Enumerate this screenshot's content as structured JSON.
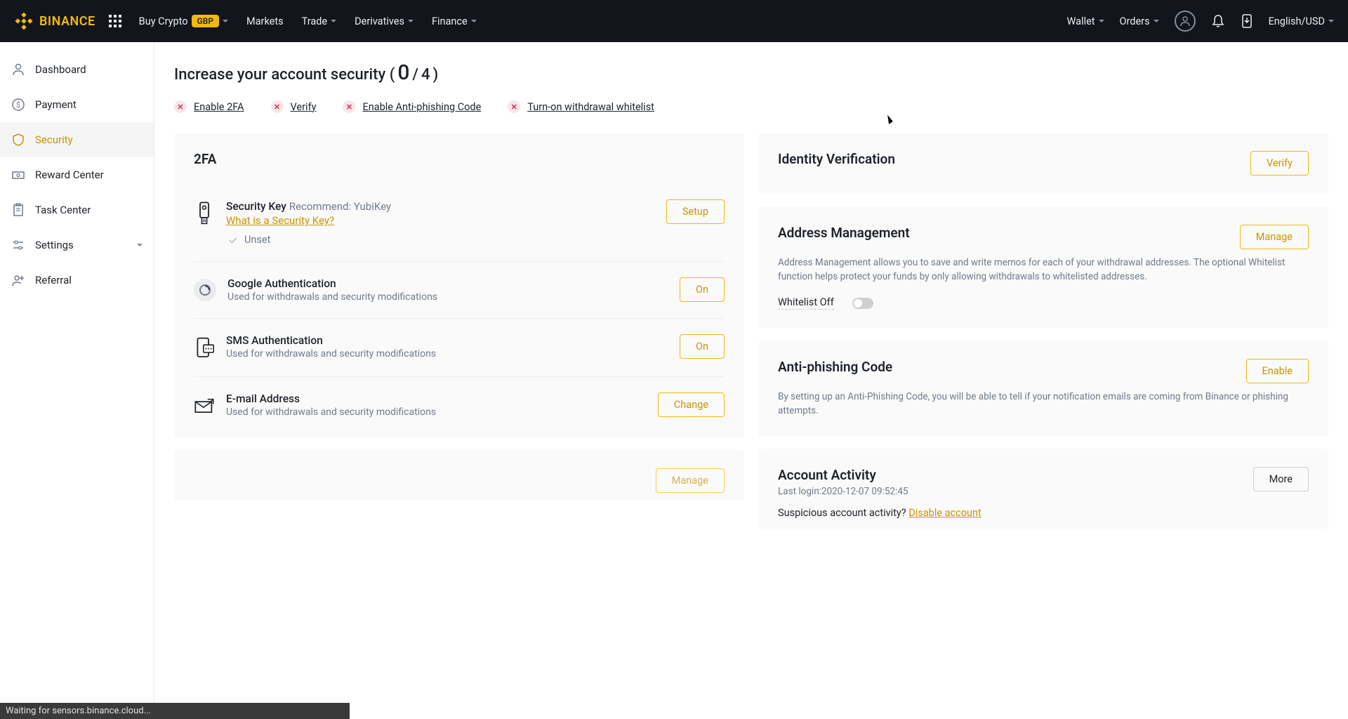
{
  "header": {
    "brand": "BINANCE",
    "nav": {
      "buy_crypto": "Buy Crypto",
      "gbp_badge": "GBP",
      "markets": "Markets",
      "trade": "Trade",
      "derivatives": "Derivatives",
      "finance": "Finance",
      "wallet": "Wallet",
      "orders": "Orders",
      "lang": "English/USD"
    }
  },
  "sidebar": {
    "dashboard": "Dashboard",
    "payment": "Payment",
    "security": "Security",
    "reward_center": "Reward Center",
    "task_center": "Task Center",
    "settings": "Settings",
    "referral": "Referral"
  },
  "page": {
    "title_pre": "Increase your account security (",
    "title_count": "0",
    "title_sep": " / ",
    "title_total": "4",
    "title_post": " )",
    "links": {
      "enable_2fa": "Enable 2FA",
      "verify": "Verify",
      "antiphishing": "Enable Anti-phishing Code",
      "whitelist": "Turn-on withdrawal whitelist"
    }
  },
  "twofa": {
    "title": "2FA",
    "security_key": {
      "label": "Security Key",
      "hint": "Recommend: YubiKey",
      "link": "What is a Security Key?",
      "button": "Setup",
      "status": "Unset"
    },
    "google_auth": {
      "label": "Google Authentication",
      "sub": "Used for withdrawals and security modifications",
      "button": "On"
    },
    "sms": {
      "label": "SMS Authentication",
      "sub": "Used for withdrawals and security modifications",
      "button": "On"
    },
    "email": {
      "label": "E-mail Address",
      "sub": "Used for withdrawals and security modifications",
      "button": "Change"
    },
    "manage": "Manage"
  },
  "identity": {
    "title": "Identity Verification",
    "button": "Verify"
  },
  "address_mgmt": {
    "title": "Address Management",
    "desc": "Address Management allows you to save and write memos for each of your withdrawal addresses. The optional Whitelist function helps protect your funds by only allowing withdrawals to whitelisted addresses.",
    "button": "Manage",
    "whitelist_label": "Whitelist Off"
  },
  "antiphishing": {
    "title": "Anti-phishing Code",
    "desc": "By setting up an Anti-Phishing Code, you will be able to tell if your notification emails are coming from Binance or phishing attempts.",
    "button": "Enable"
  },
  "activity": {
    "title": "Account Activity",
    "last_login_label": "Last login:",
    "last_login_value": "2020-12-07 09:52:45",
    "button": "More",
    "suspicious_label": "Suspicious account activity?",
    "disable_link": "Disable account"
  },
  "status_bar": "Waiting for sensors.binance.cloud..."
}
